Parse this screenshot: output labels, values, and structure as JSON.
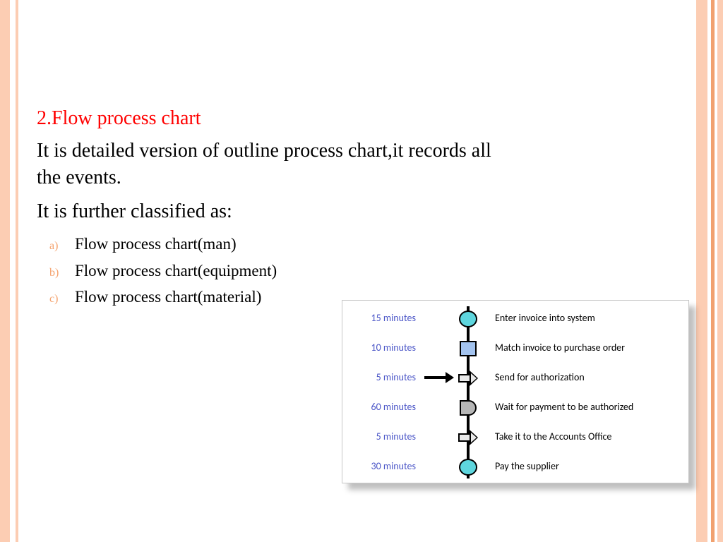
{
  "title": "2.Flow process chart",
  "description": "It is detailed version of outline process chart,it records all the events.",
  "subheading": "It is further classified as:",
  "items": [
    {
      "marker": "a)",
      "text": "Flow process chart(man)"
    },
    {
      "marker": "b)",
      "text": "Flow process chart(equipment)"
    },
    {
      "marker": "c)",
      "text": "Flow process chart(material)"
    }
  ],
  "diagram": {
    "steps": [
      {
        "time": "15 minutes",
        "text": "Enter invoice into system",
        "shape": "circle",
        "branch": false
      },
      {
        "time": "10 minutes",
        "text": "Match invoice to purchase order",
        "shape": "square",
        "branch": false
      },
      {
        "time": "5 minutes",
        "text": "Send for authorization",
        "shape": "arrow",
        "branch": true
      },
      {
        "time": "60 minutes",
        "text": "Wait for payment to be authorized",
        "shape": "dshape",
        "branch": false
      },
      {
        "time": "5 minutes",
        "text": "Take it to the Accounts Office",
        "shape": "arrow",
        "branch": false
      },
      {
        "time": "30 minutes",
        "text": "Pay the supplier",
        "shape": "circle",
        "branch": false
      }
    ]
  }
}
